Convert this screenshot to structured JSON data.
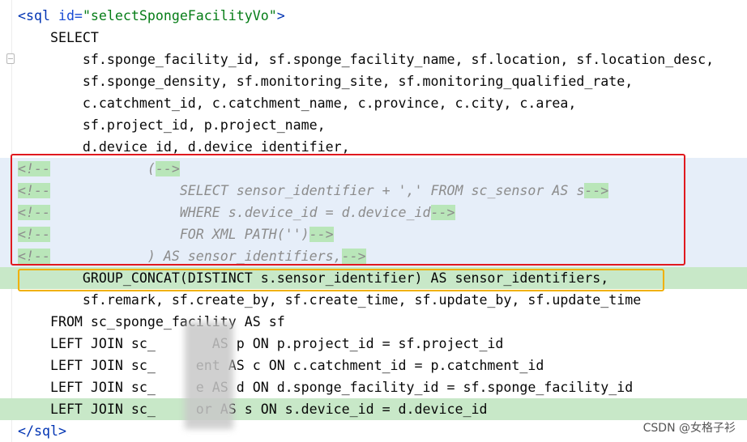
{
  "colors": {
    "comment_block_bg": "#e6eef9",
    "highlight_green_bg": "#c8e8c8",
    "red_box": "#e0191f",
    "yellow_box": "#f0b000",
    "tag_color": "#0033b3",
    "string_color": "#067d17",
    "comment_color": "#8c8c8c"
  },
  "code": {
    "line1": {
      "open": "<sql ",
      "attr": "id=",
      "value": "\"selectSpongeFacilityVo\"",
      "close": ">"
    },
    "line2": "    SELECT",
    "line3": "        sf.sponge_facility_id, sf.sponge_facility_name, sf.location, sf.location_desc,",
    "line4": "        sf.sponge_density, sf.monitoring_site, sf.monitoring_qualified_rate,",
    "line5": "        c.catchment_id, c.catchment_name, c.province, c.city, c.area,",
    "line6": "        sf.project_id, p.project_name,",
    "line7": "        d.device_id, d.device_identifier,",
    "line8": {
      "open": "<!--",
      "body": "            (",
      "close": "-->"
    },
    "line9": {
      "open": "<!--",
      "body": "                SELECT sensor_identifier + ',' FROM sc_sensor AS s",
      "close": "-->"
    },
    "line10": {
      "open": "<!--",
      "body": "                WHERE s.device_id = d.device_id",
      "close": "-->"
    },
    "line11": {
      "open": "<!--",
      "body": "                FOR XML PATH('')",
      "close": "-->"
    },
    "line12": {
      "open": "<!--",
      "body": "            ) AS sensor_identifiers,",
      "close": "-->"
    },
    "line13": "        GROUP_CONCAT(DISTINCT s.sensor_identifier) AS sensor_identifiers,",
    "line14": "        sf.remark, sf.create_by, sf.create_time, sf.update_by, sf.update_time",
    "line15": "    FROM sc_sponge_facility AS sf",
    "line16": "    LEFT JOIN sc_       AS p ON p.project_id = sf.project_id",
    "line17": "    LEFT JOIN sc_     ent AS c ON c.catchment_id = p.catchment_id",
    "line18": "    LEFT JOIN sc_     e AS d ON d.sponge_facility_id = sf.sponge_facility_id",
    "line19": "    LEFT JOIN sc_     or AS s ON s.device_id = d.device_id",
    "line20": "</sql>"
  },
  "watermark": "CSDN @女格子衫"
}
